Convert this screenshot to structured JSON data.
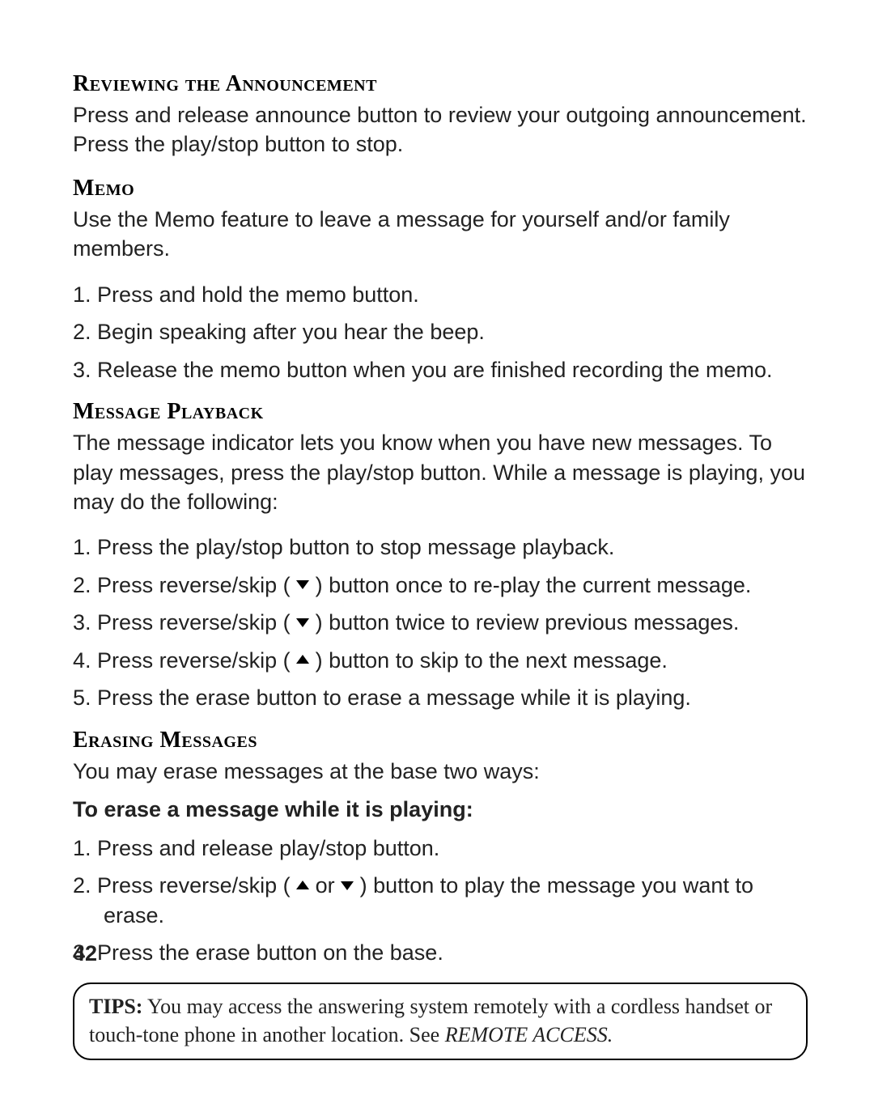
{
  "page_number": "42",
  "sections": {
    "review": {
      "heading": "Reviewing the Announcement",
      "body": "Press and release announce button to review your outgoing announcement. Press the play/stop button to stop."
    },
    "memo": {
      "heading": "Memo",
      "body": "Use the Memo feature to leave a message for yourself and/or family members.",
      "steps": [
        "Press and hold the memo button.",
        "Begin speaking after you hear the beep.",
        "Release the memo button when you are finished recording the memo."
      ]
    },
    "playback": {
      "heading": "Message Playback",
      "body": "The message indicator lets you know when you have new messages. To play messages, press the play/stop button. While a message is playing, you may do the following:",
      "steps": {
        "s1": "Press the play/stop button to stop message playback.",
        "s2a": "Press reverse/skip (",
        "s2b": ") button once to re-play the current message.",
        "s3a": "Press reverse/skip (",
        "s3b": ") button twice to review previous messages.",
        "s4a": "Press reverse/skip (",
        "s4b": ") button to skip to the next message.",
        "s5": "Press the erase button to erase a message while it is playing."
      }
    },
    "erase": {
      "heading": "Erasing Messages",
      "body": "You may erase messages at the base two ways:",
      "sub_heading": "To erase a message while it is playing:",
      "steps": {
        "s1": "Press and release play/stop button.",
        "s2a": "Press reverse/skip (",
        "s2or": " or ",
        "s2b": ") button to play the message you want to erase.",
        "s3": "Press the erase button on the base."
      }
    }
  },
  "tips": {
    "label": "TIPS:",
    "body": " You may access the answering system remotely with a cordless handset or touch-tone phone in another location. See ",
    "ref": "REMOTE ACCESS."
  }
}
